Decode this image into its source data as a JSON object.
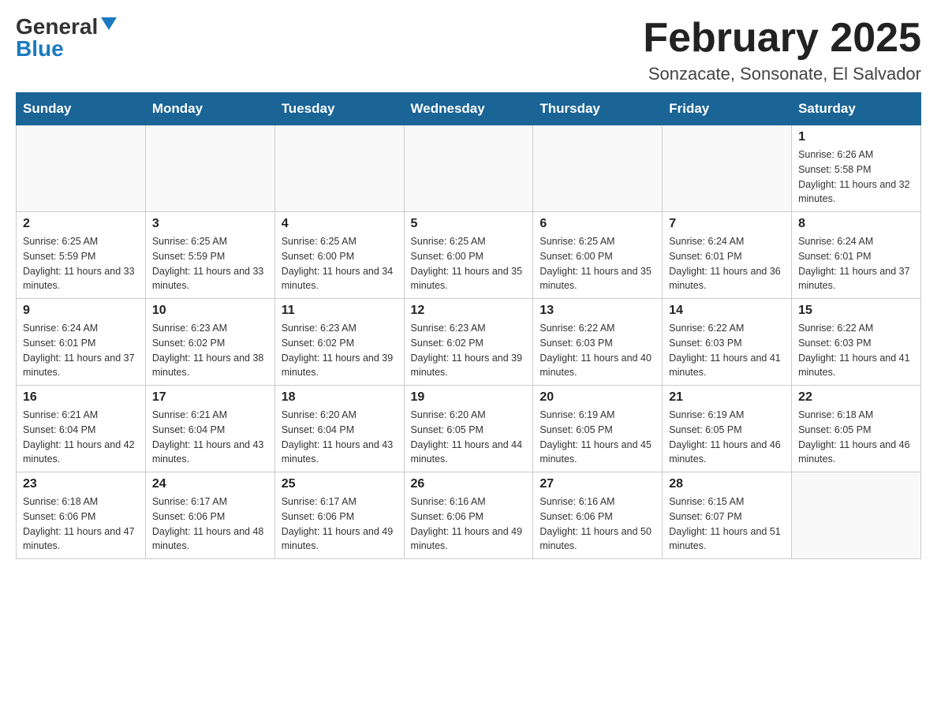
{
  "header": {
    "logo_general": "General",
    "logo_blue": "Blue",
    "month_title": "February 2025",
    "location": "Sonzacate, Sonsonate, El Salvador"
  },
  "days_of_week": [
    "Sunday",
    "Monday",
    "Tuesday",
    "Wednesday",
    "Thursday",
    "Friday",
    "Saturday"
  ],
  "weeks": [
    [
      {
        "day": "",
        "info": ""
      },
      {
        "day": "",
        "info": ""
      },
      {
        "day": "",
        "info": ""
      },
      {
        "day": "",
        "info": ""
      },
      {
        "day": "",
        "info": ""
      },
      {
        "day": "",
        "info": ""
      },
      {
        "day": "1",
        "info": "Sunrise: 6:26 AM\nSunset: 5:58 PM\nDaylight: 11 hours and 32 minutes."
      }
    ],
    [
      {
        "day": "2",
        "info": "Sunrise: 6:25 AM\nSunset: 5:59 PM\nDaylight: 11 hours and 33 minutes."
      },
      {
        "day": "3",
        "info": "Sunrise: 6:25 AM\nSunset: 5:59 PM\nDaylight: 11 hours and 33 minutes."
      },
      {
        "day": "4",
        "info": "Sunrise: 6:25 AM\nSunset: 6:00 PM\nDaylight: 11 hours and 34 minutes."
      },
      {
        "day": "5",
        "info": "Sunrise: 6:25 AM\nSunset: 6:00 PM\nDaylight: 11 hours and 35 minutes."
      },
      {
        "day": "6",
        "info": "Sunrise: 6:25 AM\nSunset: 6:00 PM\nDaylight: 11 hours and 35 minutes."
      },
      {
        "day": "7",
        "info": "Sunrise: 6:24 AM\nSunset: 6:01 PM\nDaylight: 11 hours and 36 minutes."
      },
      {
        "day": "8",
        "info": "Sunrise: 6:24 AM\nSunset: 6:01 PM\nDaylight: 11 hours and 37 minutes."
      }
    ],
    [
      {
        "day": "9",
        "info": "Sunrise: 6:24 AM\nSunset: 6:01 PM\nDaylight: 11 hours and 37 minutes."
      },
      {
        "day": "10",
        "info": "Sunrise: 6:23 AM\nSunset: 6:02 PM\nDaylight: 11 hours and 38 minutes."
      },
      {
        "day": "11",
        "info": "Sunrise: 6:23 AM\nSunset: 6:02 PM\nDaylight: 11 hours and 39 minutes."
      },
      {
        "day": "12",
        "info": "Sunrise: 6:23 AM\nSunset: 6:02 PM\nDaylight: 11 hours and 39 minutes."
      },
      {
        "day": "13",
        "info": "Sunrise: 6:22 AM\nSunset: 6:03 PM\nDaylight: 11 hours and 40 minutes."
      },
      {
        "day": "14",
        "info": "Sunrise: 6:22 AM\nSunset: 6:03 PM\nDaylight: 11 hours and 41 minutes."
      },
      {
        "day": "15",
        "info": "Sunrise: 6:22 AM\nSunset: 6:03 PM\nDaylight: 11 hours and 41 minutes."
      }
    ],
    [
      {
        "day": "16",
        "info": "Sunrise: 6:21 AM\nSunset: 6:04 PM\nDaylight: 11 hours and 42 minutes."
      },
      {
        "day": "17",
        "info": "Sunrise: 6:21 AM\nSunset: 6:04 PM\nDaylight: 11 hours and 43 minutes."
      },
      {
        "day": "18",
        "info": "Sunrise: 6:20 AM\nSunset: 6:04 PM\nDaylight: 11 hours and 43 minutes."
      },
      {
        "day": "19",
        "info": "Sunrise: 6:20 AM\nSunset: 6:05 PM\nDaylight: 11 hours and 44 minutes."
      },
      {
        "day": "20",
        "info": "Sunrise: 6:19 AM\nSunset: 6:05 PM\nDaylight: 11 hours and 45 minutes."
      },
      {
        "day": "21",
        "info": "Sunrise: 6:19 AM\nSunset: 6:05 PM\nDaylight: 11 hours and 46 minutes."
      },
      {
        "day": "22",
        "info": "Sunrise: 6:18 AM\nSunset: 6:05 PM\nDaylight: 11 hours and 46 minutes."
      }
    ],
    [
      {
        "day": "23",
        "info": "Sunrise: 6:18 AM\nSunset: 6:06 PM\nDaylight: 11 hours and 47 minutes."
      },
      {
        "day": "24",
        "info": "Sunrise: 6:17 AM\nSunset: 6:06 PM\nDaylight: 11 hours and 48 minutes."
      },
      {
        "day": "25",
        "info": "Sunrise: 6:17 AM\nSunset: 6:06 PM\nDaylight: 11 hours and 49 minutes."
      },
      {
        "day": "26",
        "info": "Sunrise: 6:16 AM\nSunset: 6:06 PM\nDaylight: 11 hours and 49 minutes."
      },
      {
        "day": "27",
        "info": "Sunrise: 6:16 AM\nSunset: 6:06 PM\nDaylight: 11 hours and 50 minutes."
      },
      {
        "day": "28",
        "info": "Sunrise: 6:15 AM\nSunset: 6:07 PM\nDaylight: 11 hours and 51 minutes."
      },
      {
        "day": "",
        "info": ""
      }
    ]
  ]
}
